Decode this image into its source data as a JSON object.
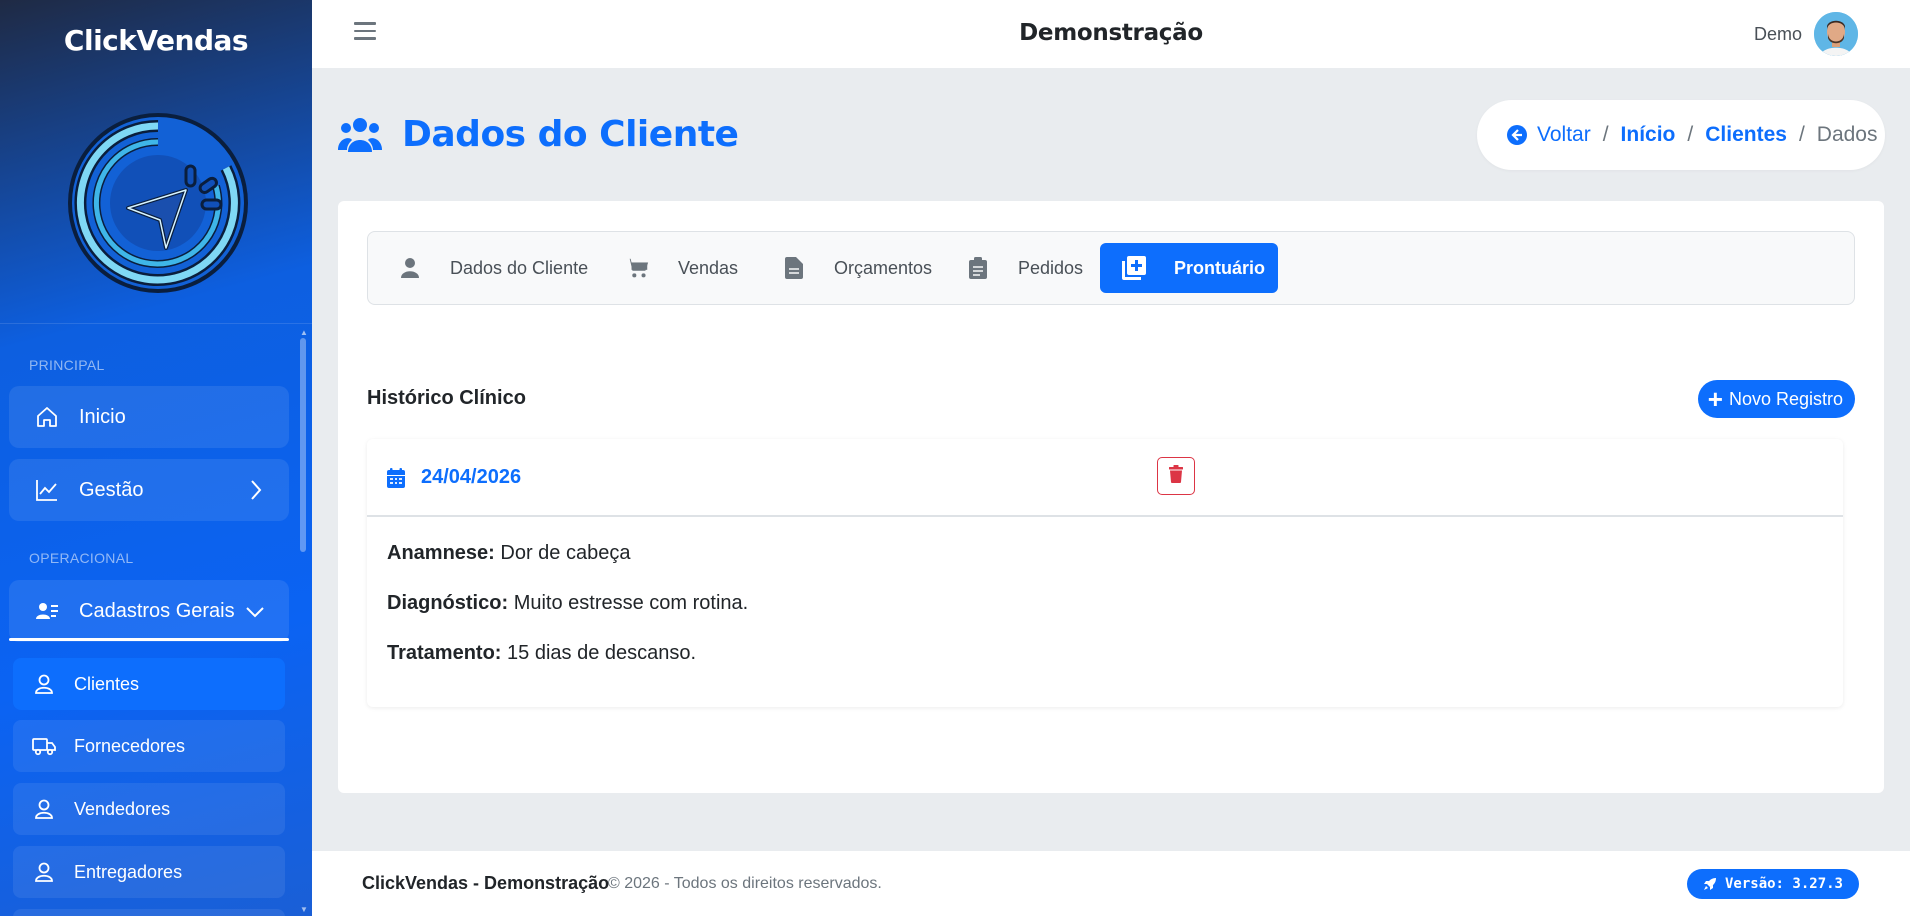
{
  "sidebar": {
    "brand": "ClickVendas",
    "sections": {
      "principal": "PRINCIPAL",
      "operacional": "OPERACIONAL"
    },
    "items": {
      "inicio": "Inicio",
      "gestao": "Gestão",
      "cadastros": "Cadastros Gerais"
    },
    "subitems": {
      "clientes": "Clientes",
      "fornecedores": "Fornecedores",
      "vendedores": "Vendedores",
      "entregadores": "Entregadores"
    }
  },
  "topbar": {
    "title": "Demonstração",
    "user": "Demo"
  },
  "header": {
    "title": "Dados do Cliente",
    "breadcrumb": {
      "back": "Voltar",
      "inicio": "Início",
      "clientes": "Clientes",
      "current": "Dados",
      "separator": "/"
    }
  },
  "tabs": {
    "dados": "Dados do Cliente",
    "vendas": "Vendas",
    "orcamentos": "Orçamentos",
    "pedidos": "Pedidos",
    "prontuario": "Prontuário"
  },
  "history": {
    "title": "Histórico Clínico",
    "new_button": "Novo Registro",
    "record": {
      "date": "24/04/2026",
      "anamnese_label": "Anamnese:",
      "anamnese": "Dor de cabeça",
      "diagnostico_label": "Diagnóstico:",
      "diagnostico": "Muito estresse com rotina.",
      "tratamento_label": "Tratamento:",
      "tratamento": "15 dias de descanso."
    }
  },
  "footer": {
    "brand": "ClickVendas - Demonstração",
    "copyright": "© 2026  - Todos os direitos reservados.",
    "version": "Versão: 3.27.3"
  },
  "colors": {
    "primary": "#0d6efd",
    "danger": "#dc3545",
    "sidebar": "#0b63f3"
  },
  "icons": {
    "users": "users-icon",
    "back": "arrow-circle-left-icon",
    "home": "home-icon",
    "chart": "chart-line-icon",
    "id_card": "address-card-icon",
    "user": "user-icon",
    "truck": "truck-icon",
    "cart": "cart-icon",
    "file": "file-icon",
    "clipboard": "clipboard-icon",
    "notes_medical": "notes-medical-icon",
    "calendar": "calendar-icon",
    "trash": "trash-icon",
    "rocket": "rocket-icon"
  }
}
